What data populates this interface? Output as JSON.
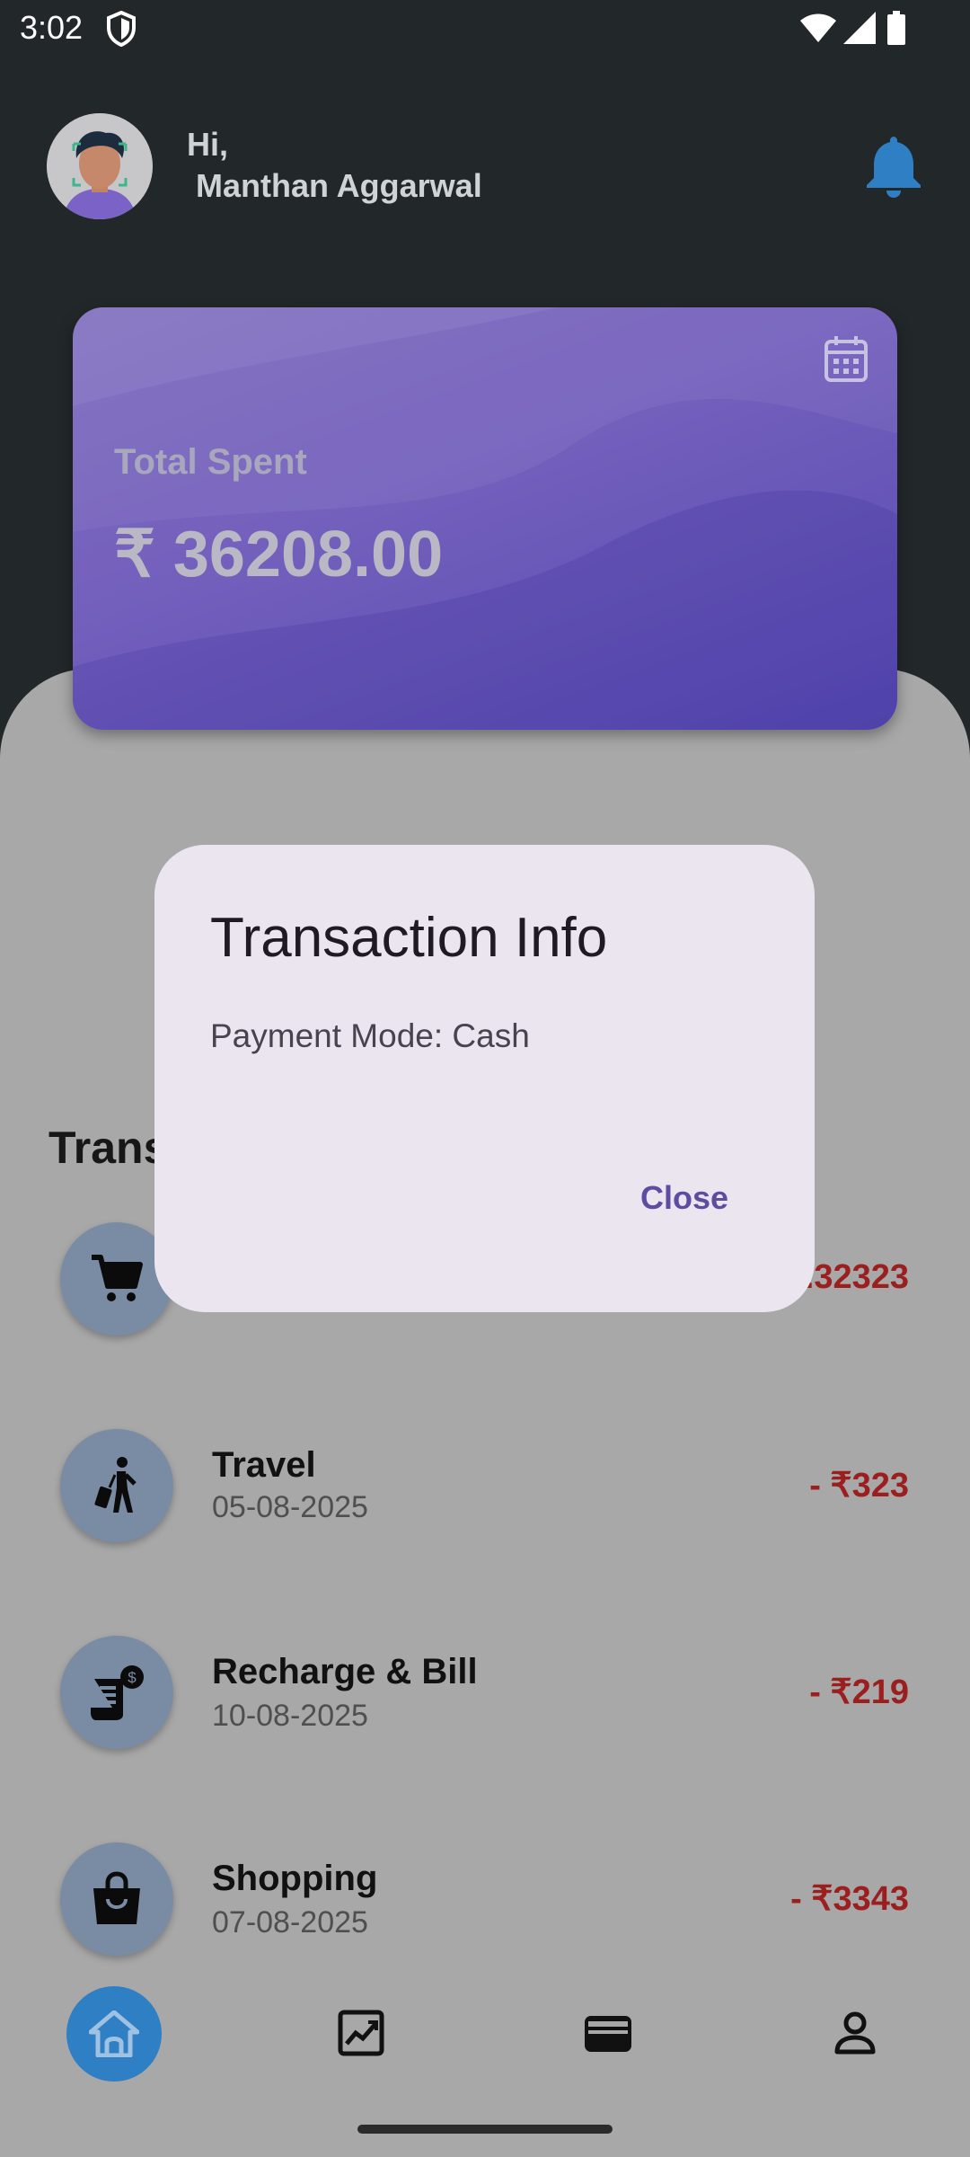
{
  "status_bar": {
    "time": "3:02"
  },
  "header": {
    "greeting": "Hi,",
    "user_name": " Manthan Aggarwal"
  },
  "summary_card": {
    "label": "Total Spent",
    "amount": "₹ 36208.00"
  },
  "transactions": {
    "section_title": "Trans",
    "items": [
      {
        "title": "",
        "date": "",
        "amount": ".32323",
        "icon": "shopping-cart-icon"
      },
      {
        "title": "Travel",
        "date": "05-08-2025",
        "amount": "- ₹323",
        "icon": "traveler-luggage-icon"
      },
      {
        "title": "Recharge & Bill",
        "date": "10-08-2025",
        "amount": "- ₹219",
        "icon": "bill-receipt-icon"
      },
      {
        "title": "Shopping",
        "date": "07-08-2025",
        "amount": "- ₹3343",
        "icon": "shopping-bag-icon"
      }
    ]
  },
  "dialog": {
    "title": "Transaction Info",
    "body": "Payment Mode: Cash",
    "close_label": "Close"
  },
  "bottom_nav": [
    "home-icon",
    "analytics-icon",
    "wallet-icon",
    "profile-icon"
  ],
  "colors": {
    "accent": "#2f7fc4",
    "card_gradient_start": "#7e6cbe",
    "card_gradient_end": "#5549b0",
    "expense_red": "#9b1f1f",
    "dialog_bg": "#ebe5ef",
    "dialog_action": "#5d4ca0"
  }
}
